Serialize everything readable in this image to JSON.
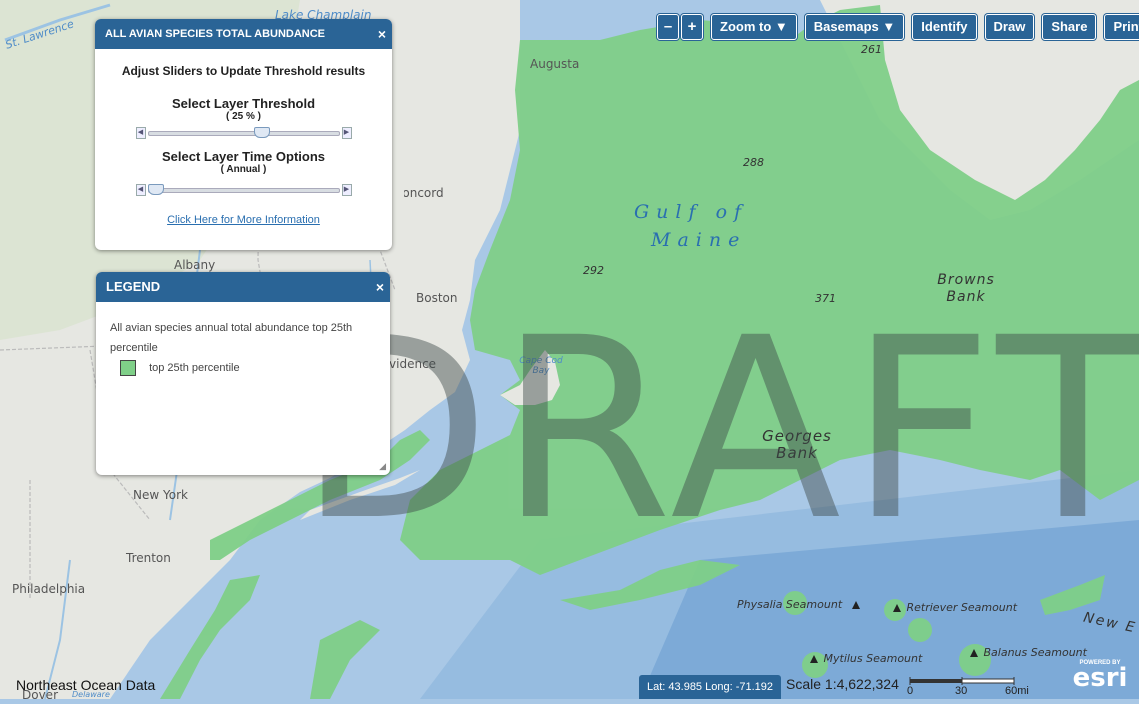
{
  "map": {
    "place_labels": [
      "St. Lawrence",
      "Lake Champlain",
      "Augusta",
      "Concord",
      "Albany",
      "Boston",
      "Providence",
      "Cape Cod Bay",
      "New York",
      "Trenton",
      "Philadelphia",
      "Dover",
      "Delaware"
    ],
    "ocean_label_1": "Gulf  of",
    "ocean_label_2": "Maine",
    "banks": {
      "browns_1": "Browns",
      "browns_2": "Bank",
      "georges_1": "Georges",
      "georges_2": "Bank"
    },
    "depths": [
      "261",
      "288",
      "292",
      "371"
    ],
    "seamounts": [
      "Physalia Seamount",
      "Retriever Seamount",
      "Mytilus Seamount",
      "Balanus Seamount"
    ],
    "new_england_label": "New E",
    "watermark": "DRAFT",
    "colors": {
      "ocean": "#a9c8e6",
      "land": "#e6e7e2",
      "abundance": "#7fcf88",
      "panel_header": "#2a6496"
    }
  },
  "toolbar": {
    "zoom_out": "–",
    "zoom_in": "+",
    "zoom_to": "Zoom to ▼",
    "basemaps": "Basemaps ▼",
    "identify": "Identify",
    "draw": "Draw",
    "share": "Share",
    "print": "Print"
  },
  "threshold_panel": {
    "title": "ALL AVIAN SPECIES TOTAL ABUNDANCE",
    "close": "×",
    "instruction": "Adjust Sliders to Update Threshold results",
    "threshold_label": "Select Layer Threshold",
    "threshold_value": "( 25 % )",
    "threshold_level": 0.6,
    "time_label": "Select Layer Time Options",
    "time_value": "( Annual )",
    "time_level": 0.0,
    "info_link": "Click Here for More Information"
  },
  "legend_panel": {
    "title": "LEGEND",
    "close": "×",
    "description": "All avian species annual total abundance top 25th percentile",
    "item_label": "top 25th percentile",
    "item_color": "#7fcf88"
  },
  "footer": {
    "attribution": "Northeast Ocean Data",
    "latlong": "Lat: 43.985  Long: -71.192",
    "scale": "Scale 1:4,622,324",
    "scalebar_labels": [
      "0",
      "30",
      "60mi"
    ],
    "esri_powered": "POWERED BY",
    "esri_logo": "esri"
  }
}
